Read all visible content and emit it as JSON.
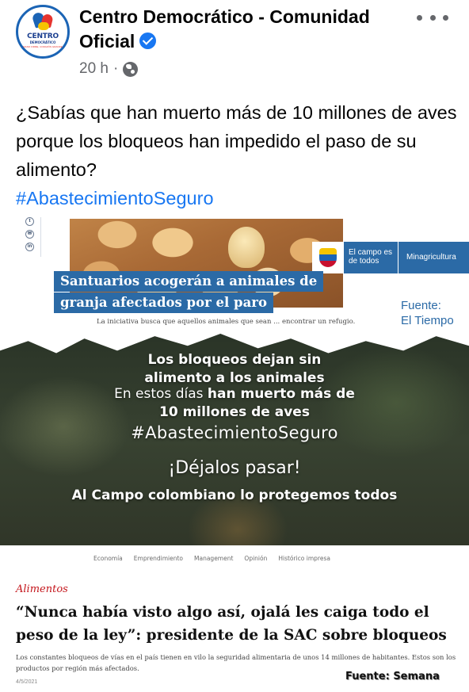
{
  "post": {
    "page_name": "Centro Democrático - Comunidad Oficial",
    "avatar_brand": "CENTRO",
    "avatar_brand_sub": "DEMOCRÁTICO",
    "avatar_tag": "MANO FIRME, CORAZÓN GRANDE",
    "time": "20 h",
    "separator": "·",
    "privacy_icon": "globe-icon",
    "more_icon": "more-horizontal-icon",
    "text_line": "¿Sabías que han muerto más de 10 millones de aves porque los bloqueos han impedido el paso de su alimento?",
    "hashtag": "#AbastecimientoSeguro",
    "accent_color": "#1877f2"
  },
  "image": {
    "panel_el_tiempo": {
      "share_icons": [
        "twitter-icon",
        "email-icon",
        "linkedin-icon"
      ],
      "headline_line1": "Santuarios acogerán a animales de",
      "headline_line2": "granja afectados por el paro",
      "lead": "La iniciativa busca que aquellos animales que sean ... encontrar un refugio.",
      "gov_campo": "El campo es de todos",
      "gov_ministry": "Minagricultura",
      "source_label": "Fuente:",
      "source_name": "El Tiempo"
    },
    "panel_banner": {
      "line1": "Los bloqueos dejan sin",
      "line2": "alimento a los animales",
      "line3_prefix": "En estos días ",
      "line3_bold": "han muerto más de",
      "line4": "10 millones de aves",
      "hashtag": "#AbastecimientoSeguro",
      "cta": "¡Déjalos pasar!",
      "slogan": "Al Campo colombiano lo protegemos todos"
    },
    "panel_semana": {
      "nav": [
        "Economía",
        "Emprendimiento",
        "Management",
        "Opinión",
        "Histórico impresa"
      ],
      "section": "Alimentos",
      "title": "“Nunca había visto algo así, ojalá les caiga todo el peso de la ley”: presidente de la SAC sobre bloqueos",
      "lead": "Los constantes bloqueos de vías en el país tienen en vilo la seguridad alimentaria de unos 14 millones de habitantes. Estos son los productos por región más afectados.",
      "date": "4/5/2021",
      "source": "Fuente: Semana"
    }
  }
}
